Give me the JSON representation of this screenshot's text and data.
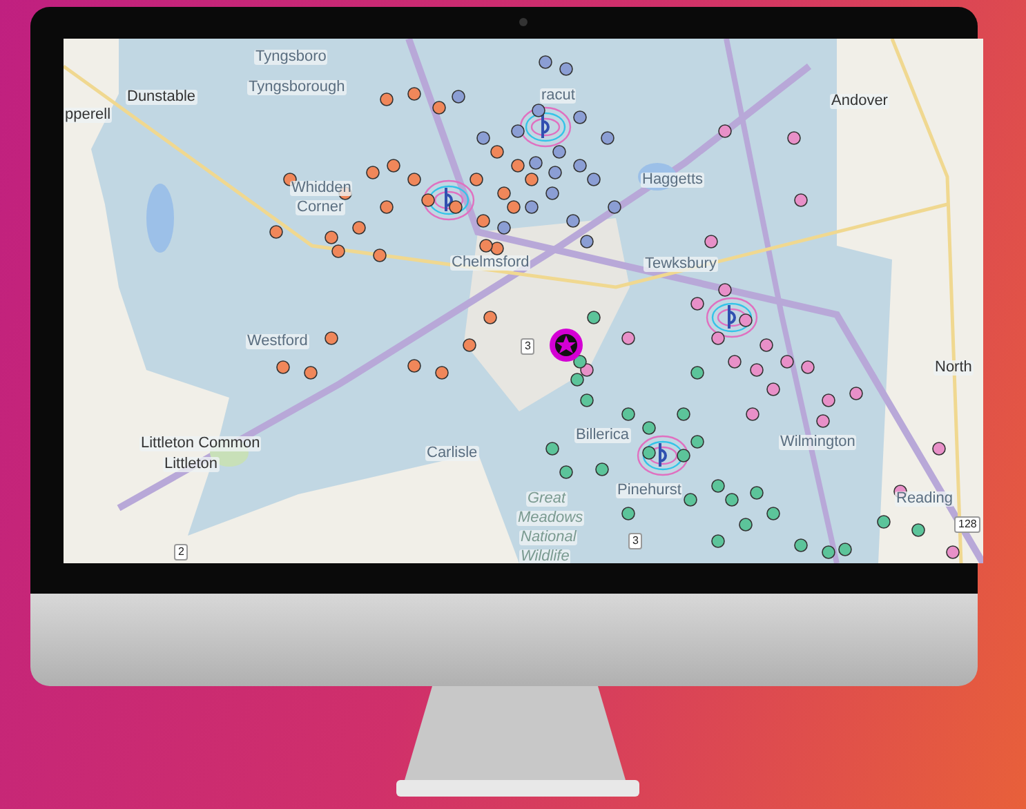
{
  "map": {
    "labels": [
      {
        "text": "Tyngsboro"
      },
      {
        "text": "Tyngsborough"
      },
      {
        "text": "Dunstable"
      },
      {
        "text": "pperell"
      },
      {
        "text": "racut"
      },
      {
        "text": "Andover"
      },
      {
        "text": "Haggetts"
      },
      {
        "text": "Whidden"
      },
      {
        "text": "Corner"
      },
      {
        "text": "Tewksbury"
      },
      {
        "text": "Chelmsford"
      },
      {
        "text": "Westford"
      },
      {
        "text": "Billerica"
      },
      {
        "text": "North"
      },
      {
        "text": "Littleton Common"
      },
      {
        "text": "Littleton"
      },
      {
        "text": "Carlisle"
      },
      {
        "text": "Wilmington"
      },
      {
        "text": "Pinehurst"
      },
      {
        "text": "Great"
      },
      {
        "text": "Meadows"
      },
      {
        "text": "National"
      },
      {
        "text": "Wildlife"
      },
      {
        "text": "Reading"
      }
    ],
    "shields": [
      {
        "text": "3"
      },
      {
        "text": "2"
      },
      {
        "text": "3"
      },
      {
        "text": "128"
      }
    ],
    "clusters": [
      {
        "color": "#f0875a"
      },
      {
        "color": "#8b9ed4"
      },
      {
        "color": "#e890c8"
      },
      {
        "color": "#5cc49a"
      }
    ],
    "center_marker": {
      "color": "#d400d4"
    }
  }
}
